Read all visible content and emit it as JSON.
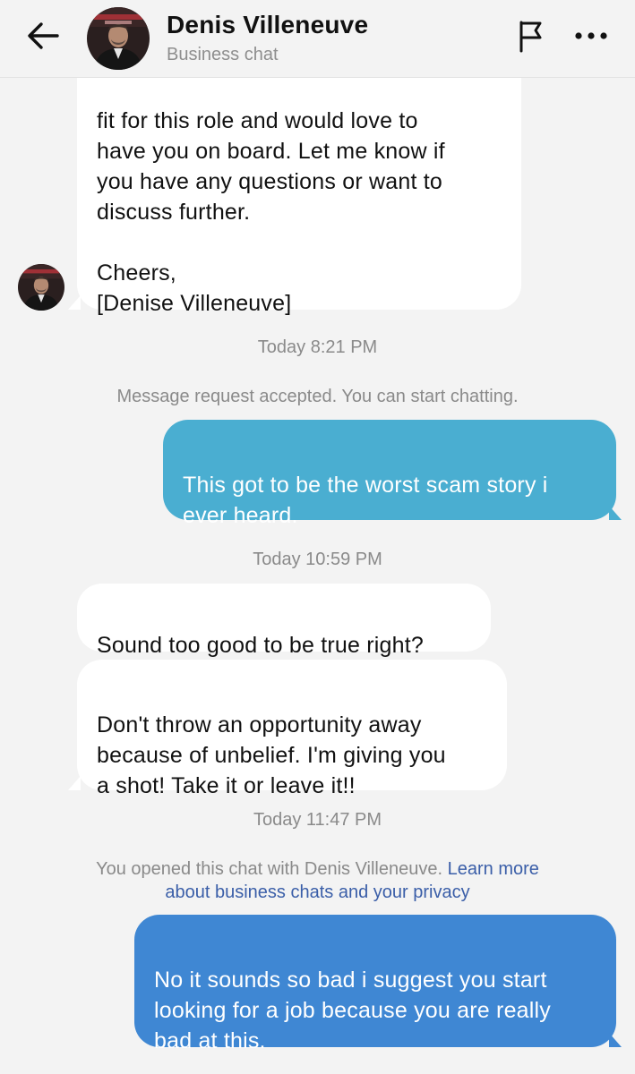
{
  "header": {
    "name": "Denis Villeneuve",
    "subtitle": "Business chat",
    "icons": {
      "back": "arrow-left-icon",
      "flag": "flag-icon",
      "more": "more-dots-icon"
    }
  },
  "messages": [
    {
      "direction": "incoming",
      "text": "fit for this role and would love to\nhave you on board. Let me know if\nyou have any questions or want to\ndiscuss further.\n\nCheers,\n[Denise Villeneuve]"
    },
    {
      "direction": "outgoing",
      "text": "This got to be the worst scam story i\never heard."
    },
    {
      "direction": "incoming",
      "text": "Sound too good to be true right?"
    },
    {
      "direction": "incoming",
      "text": "Don't throw an opportunity away\nbecause of unbelief. I'm giving you\na shot! Take it or leave it!!"
    },
    {
      "direction": "outgoing",
      "text": "No it sounds so bad i suggest you start\nlooking for a job because you are really\nbad at this."
    }
  ],
  "timestamps": [
    "Today 8:21 PM",
    "Today 10:59 PM",
    "Today 11:47 PM"
  ],
  "system": {
    "request_accepted": "Message request accepted. You can start chatting.",
    "opened_chat": "You opened this chat with Denis Villeneuve.",
    "learn_more": "Learn more",
    "privacy_link": "about business chats and your privacy"
  },
  "colors": {
    "background": "#f3f3f3",
    "incoming_bubble": "#ffffff",
    "outgoing_bubble_1": "#4aaed1",
    "outgoing_bubble_2": "#3f87d3",
    "link": "#3a5ea8"
  }
}
